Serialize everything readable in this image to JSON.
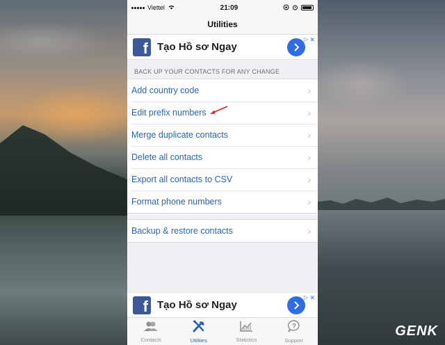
{
  "status_bar": {
    "carrier": "Viettel",
    "time": "21:09"
  },
  "nav": {
    "title": "Utilities"
  },
  "ad_top": {
    "title": "Tạo Hồ sơ Ngay",
    "fb_letter": "f"
  },
  "section": {
    "header": "BACK UP YOUR CONTACTS FOR ANY CHANGE",
    "items": [
      {
        "label": "Add country code"
      },
      {
        "label": "Edit prefix numbers"
      },
      {
        "label": "Merge duplicate contacts"
      },
      {
        "label": "Delete all contacts"
      },
      {
        "label": "Export all contacts to CSV"
      },
      {
        "label": "Format phone numbers"
      }
    ]
  },
  "section2": {
    "items": [
      {
        "label": "Backup & restore contacts"
      }
    ]
  },
  "ad_bottom": {
    "title": "Tạo Hồ sơ Ngay",
    "fb_letter": "f"
  },
  "tabs": [
    {
      "label": "Contacts",
      "icon": "contacts-icon",
      "active": false
    },
    {
      "label": "Utilities",
      "icon": "tools-icon",
      "active": true
    },
    {
      "label": "Statistics",
      "icon": "chart-icon",
      "active": false
    },
    {
      "label": "Support",
      "icon": "question-icon",
      "active": false
    }
  ],
  "watermark": {
    "text": "GENK"
  },
  "colors": {
    "accent": "#2a66b5",
    "facebook": "#3b5998",
    "ad_button": "#2f6de1",
    "annotation_arrow": "#d8232a"
  }
}
